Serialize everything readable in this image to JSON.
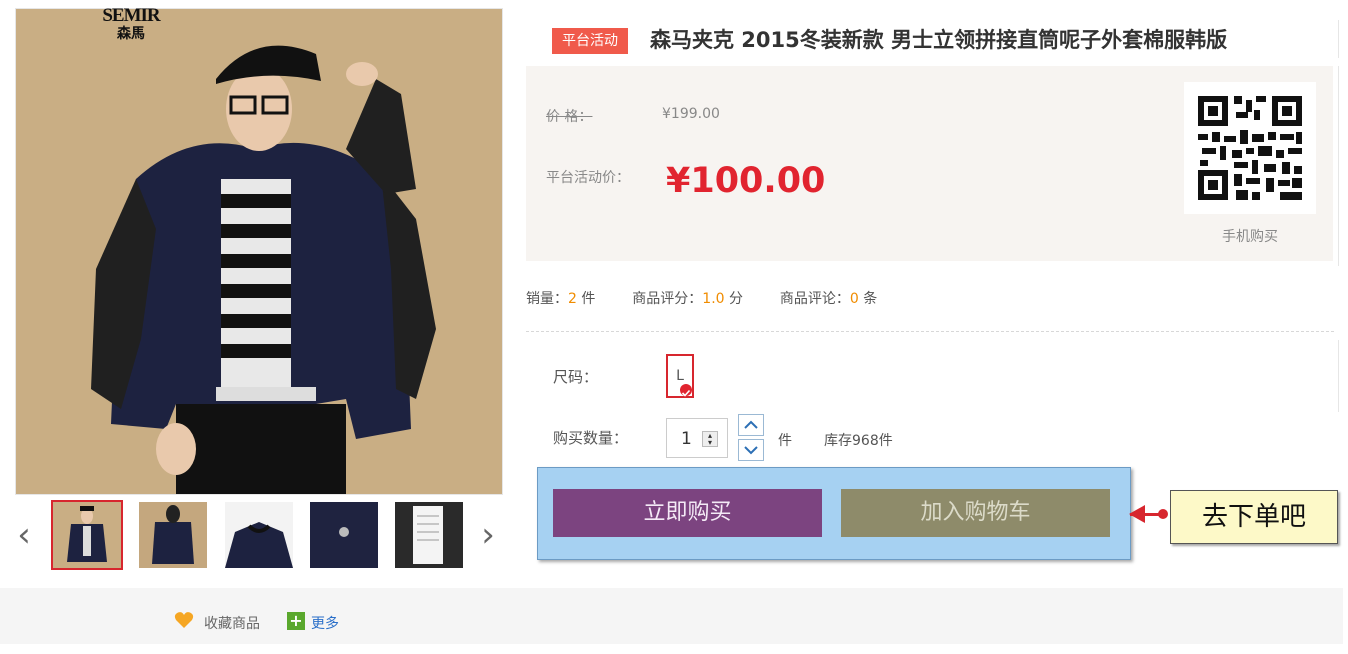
{
  "brand": {
    "en": "SEMIR",
    "zh": "森馬"
  },
  "gallery": {
    "prev_icon": "chevron-left-icon",
    "next_icon": "chevron-right-icon",
    "prev_glyph": "‹",
    "next_glyph": "›",
    "thumbnails": [
      "正面",
      "背面",
      "领口",
      "纽扣",
      "吊牌"
    ],
    "selected_index": 0
  },
  "product": {
    "promo_tag": "平台活动",
    "title": "森马夹克 2015冬装新款 男士立领拼接直筒呢子外套棉服韩版"
  },
  "price": {
    "original_label": "价 格：",
    "original_value": "¥199.00",
    "promo_label": "平台活动价：",
    "promo_value": "¥100.00"
  },
  "qr": {
    "caption": "手机购买"
  },
  "stats": {
    "sales_label": "销量：",
    "sales_value": "2",
    "sales_unit": "件",
    "rating_label": "商品评分：",
    "rating_value": "1.0",
    "rating_unit": "分",
    "reviews_label": "商品评论：",
    "reviews_value": "0",
    "reviews_unit": "条"
  },
  "size": {
    "label": "尺码：",
    "option": "L"
  },
  "quantity": {
    "label": "购买数量：",
    "value": "1",
    "unit": "件",
    "stock": "库存968件",
    "up_glyph": "⌃",
    "down_glyph": "⌄"
  },
  "actions": {
    "buy_now": "立即购买",
    "add_to_cart": "加入购物车"
  },
  "callout": {
    "text": "去下单吧"
  },
  "favorites": {
    "collect_label": "收藏商品",
    "more_label": "更多",
    "plus_glyph": "+"
  },
  "colors": {
    "accent_red": "#e1242f",
    "buy_button": "#7c4480",
    "cart_button": "#8e8b6a",
    "panel_blue": "#a6d1f2",
    "callout_yellow": "#fdf9c8"
  }
}
